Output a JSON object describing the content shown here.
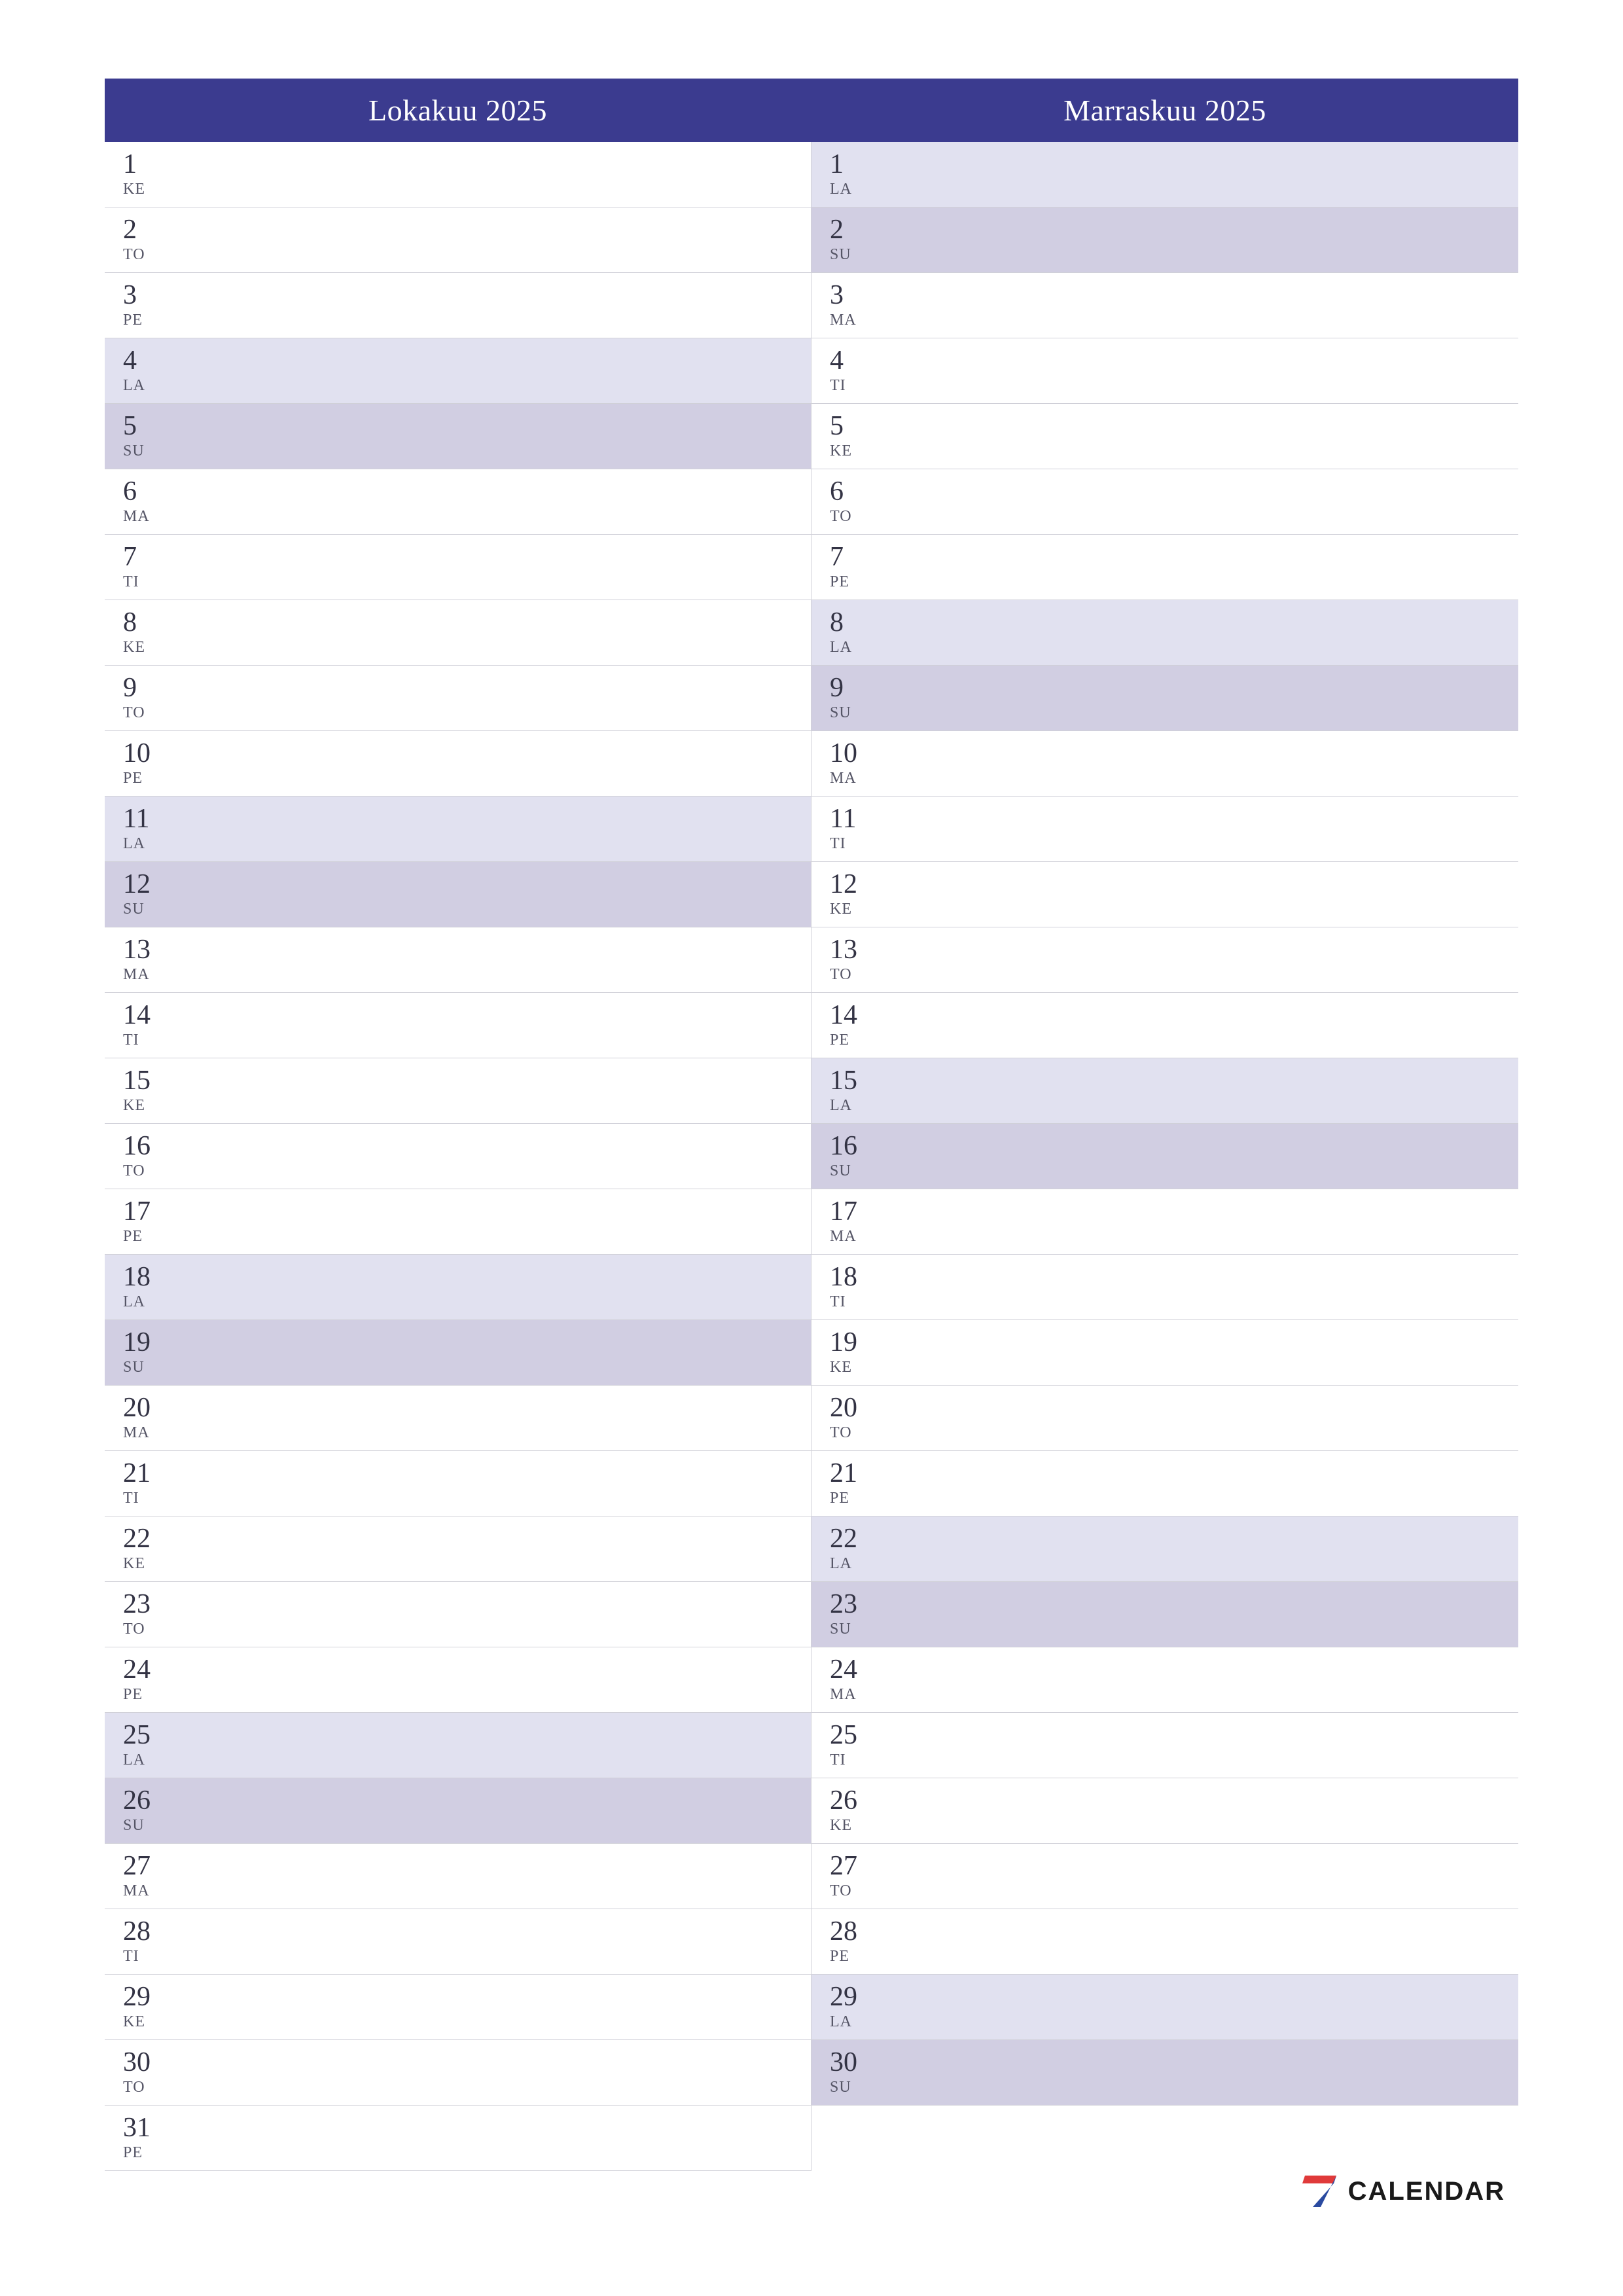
{
  "brand": {
    "name": "CALENDAR"
  },
  "months": [
    {
      "title": "Lokakuu 2025",
      "days": [
        {
          "n": "1",
          "abbr": "KE",
          "cls": ""
        },
        {
          "n": "2",
          "abbr": "TO",
          "cls": ""
        },
        {
          "n": "3",
          "abbr": "PE",
          "cls": ""
        },
        {
          "n": "4",
          "abbr": "LA",
          "cls": "sat"
        },
        {
          "n": "5",
          "abbr": "SU",
          "cls": "sun"
        },
        {
          "n": "6",
          "abbr": "MA",
          "cls": ""
        },
        {
          "n": "7",
          "abbr": "TI",
          "cls": ""
        },
        {
          "n": "8",
          "abbr": "KE",
          "cls": ""
        },
        {
          "n": "9",
          "abbr": "TO",
          "cls": ""
        },
        {
          "n": "10",
          "abbr": "PE",
          "cls": ""
        },
        {
          "n": "11",
          "abbr": "LA",
          "cls": "sat"
        },
        {
          "n": "12",
          "abbr": "SU",
          "cls": "sun"
        },
        {
          "n": "13",
          "abbr": "MA",
          "cls": ""
        },
        {
          "n": "14",
          "abbr": "TI",
          "cls": ""
        },
        {
          "n": "15",
          "abbr": "KE",
          "cls": ""
        },
        {
          "n": "16",
          "abbr": "TO",
          "cls": ""
        },
        {
          "n": "17",
          "abbr": "PE",
          "cls": ""
        },
        {
          "n": "18",
          "abbr": "LA",
          "cls": "sat"
        },
        {
          "n": "19",
          "abbr": "SU",
          "cls": "sun"
        },
        {
          "n": "20",
          "abbr": "MA",
          "cls": ""
        },
        {
          "n": "21",
          "abbr": "TI",
          "cls": ""
        },
        {
          "n": "22",
          "abbr": "KE",
          "cls": ""
        },
        {
          "n": "23",
          "abbr": "TO",
          "cls": ""
        },
        {
          "n": "24",
          "abbr": "PE",
          "cls": ""
        },
        {
          "n": "25",
          "abbr": "LA",
          "cls": "sat"
        },
        {
          "n": "26",
          "abbr": "SU",
          "cls": "sun"
        },
        {
          "n": "27",
          "abbr": "MA",
          "cls": ""
        },
        {
          "n": "28",
          "abbr": "TI",
          "cls": ""
        },
        {
          "n": "29",
          "abbr": "KE",
          "cls": ""
        },
        {
          "n": "30",
          "abbr": "TO",
          "cls": ""
        },
        {
          "n": "31",
          "abbr": "PE",
          "cls": ""
        }
      ]
    },
    {
      "title": "Marraskuu 2025",
      "days": [
        {
          "n": "1",
          "abbr": "LA",
          "cls": "sat"
        },
        {
          "n": "2",
          "abbr": "SU",
          "cls": "sun"
        },
        {
          "n": "3",
          "abbr": "MA",
          "cls": ""
        },
        {
          "n": "4",
          "abbr": "TI",
          "cls": ""
        },
        {
          "n": "5",
          "abbr": "KE",
          "cls": ""
        },
        {
          "n": "6",
          "abbr": "TO",
          "cls": ""
        },
        {
          "n": "7",
          "abbr": "PE",
          "cls": ""
        },
        {
          "n": "8",
          "abbr": "LA",
          "cls": "sat"
        },
        {
          "n": "9",
          "abbr": "SU",
          "cls": "sun"
        },
        {
          "n": "10",
          "abbr": "MA",
          "cls": ""
        },
        {
          "n": "11",
          "abbr": "TI",
          "cls": ""
        },
        {
          "n": "12",
          "abbr": "KE",
          "cls": ""
        },
        {
          "n": "13",
          "abbr": "TO",
          "cls": ""
        },
        {
          "n": "14",
          "abbr": "PE",
          "cls": ""
        },
        {
          "n": "15",
          "abbr": "LA",
          "cls": "sat"
        },
        {
          "n": "16",
          "abbr": "SU",
          "cls": "sun"
        },
        {
          "n": "17",
          "abbr": "MA",
          "cls": ""
        },
        {
          "n": "18",
          "abbr": "TI",
          "cls": ""
        },
        {
          "n": "19",
          "abbr": "KE",
          "cls": ""
        },
        {
          "n": "20",
          "abbr": "TO",
          "cls": ""
        },
        {
          "n": "21",
          "abbr": "PE",
          "cls": ""
        },
        {
          "n": "22",
          "abbr": "LA",
          "cls": "sat"
        },
        {
          "n": "23",
          "abbr": "SU",
          "cls": "sun"
        },
        {
          "n": "24",
          "abbr": "MA",
          "cls": ""
        },
        {
          "n": "25",
          "abbr": "TI",
          "cls": ""
        },
        {
          "n": "26",
          "abbr": "KE",
          "cls": ""
        },
        {
          "n": "27",
          "abbr": "TO",
          "cls": ""
        },
        {
          "n": "28",
          "abbr": "PE",
          "cls": ""
        },
        {
          "n": "29",
          "abbr": "LA",
          "cls": "sat"
        },
        {
          "n": "30",
          "abbr": "SU",
          "cls": "sun"
        }
      ]
    }
  ]
}
